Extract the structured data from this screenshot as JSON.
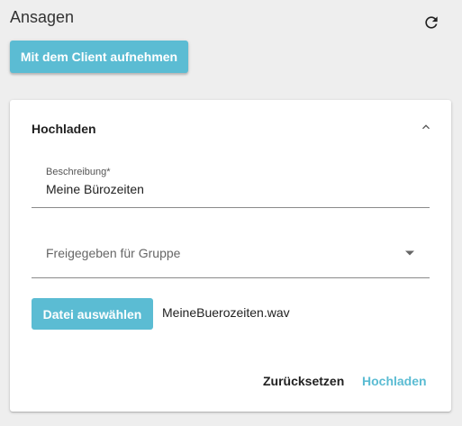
{
  "header": {
    "title": "Ansagen",
    "refresh_icon": "refresh-icon"
  },
  "toolbar": {
    "record_client_label": "Mit dem Client aufnehmen"
  },
  "upload_panel": {
    "title": "Hochladen",
    "collapse_icon": "chevron-up-icon",
    "description": {
      "label": "Beschreibung*",
      "value": "Meine Bürozeiten"
    },
    "group_select": {
      "placeholder": "Freigegeben für Gruppe",
      "icon": "dropdown-arrow-icon"
    },
    "file": {
      "button_label": "Datei auswählen",
      "selected_name": "MeineBuerozeiten.wav"
    },
    "actions": {
      "reset_label": "Zurücksetzen",
      "upload_label": "Hochladen"
    }
  },
  "colors": {
    "accent": "#5bbcd3",
    "background": "#eeeeee",
    "card": "#ffffff"
  }
}
